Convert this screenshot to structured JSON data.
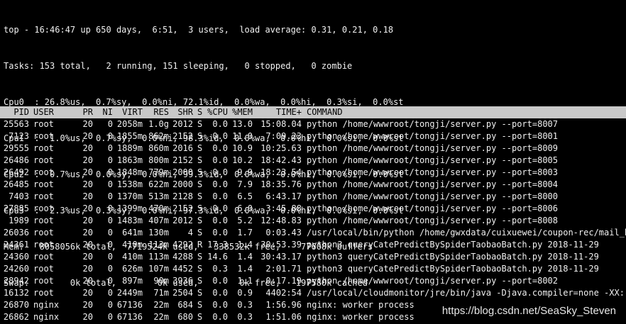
{
  "summary": {
    "uptime_line": "top - 16:46:47 up 650 days,  6:51,  3 users,  load average: 0.31, 0.21, 0.18",
    "tasks_line": "Tasks: 153 total,   2 running, 151 sleeping,   0 stopped,   0 zombie",
    "cpu_lines": [
      "Cpu0  : 26.8%us,  0.7%sy,  0.0%ni, 72.1%id,  0.0%wa,  0.0%hi,  0.3%si,  0.0%st",
      "Cpu1  :  1.0%us,  0.7%sy,  0.0%ni, 98.3%id,  0.0%wa,  0.0%hi,  0.0%si,  0.0%st",
      "Cpu2  :  0.7%us,  0.0%sy,  0.0%ni, 99.3%id,  0.0%wa,  0.0%hi,  0.0%si,  0.0%st",
      "Cpu3  :  2.3%us,  0.3%sy,  0.0%ni, 97.3%id,  0.0%wa,  0.0%hi,  0.0%si,  0.0%st"
    ],
    "mem_line": "Mem:   8058056k total,  7719524k used,   338532k free,    77608k buffers",
    "swap_line": "Swap:        0k total,        0k used,        0k free,   197580k cached"
  },
  "columns": [
    "PID",
    "USER",
    "PR",
    "NI",
    "VIRT",
    "RES",
    "SHR",
    "S",
    "%CPU",
    "%MEM",
    "TIME+",
    "COMMAND"
  ],
  "processes": [
    {
      "pid": "25563",
      "user": "root",
      "pr": "20",
      "ni": "0",
      "virt": "2058m",
      "res": "1.0g",
      "shr": "2012",
      "s": "S",
      "cpu": "0.0",
      "mem": "13.0",
      "time": "15:08.04",
      "command": "python /home/wwwroot/tongji/server.py --port=8007"
    },
    {
      "pid": "7123",
      "user": "root",
      "pr": "20",
      "ni": "0",
      "virt": "1855m",
      "res": "862m",
      "shr": "2152",
      "s": "S",
      "cpu": "0.0",
      "mem": "11.0",
      "time": "7:09.23",
      "command": "python /home/wwwroot/tongji/server.py --port=8001"
    },
    {
      "pid": "29555",
      "user": "root",
      "pr": "20",
      "ni": "0",
      "virt": "1889m",
      "res": "860m",
      "shr": "2016",
      "s": "S",
      "cpu": "0.0",
      "mem": "10.9",
      "time": "10:25.63",
      "command": "python /home/wwwroot/tongji/server.py --port=8009"
    },
    {
      "pid": "26486",
      "user": "root",
      "pr": "20",
      "ni": "0",
      "virt": "1863m",
      "res": "800m",
      "shr": "2152",
      "s": "S",
      "cpu": "0.0",
      "mem": "10.2",
      "time": "18:42.43",
      "command": "python /home/wwwroot/tongji/server.py --port=8005"
    },
    {
      "pid": "26492",
      "user": "root",
      "pr": "20",
      "ni": "0",
      "virt": "1848m",
      "res": "779m",
      "shr": "2000",
      "s": "S",
      "cpu": "0.0",
      "mem": "9.9",
      "time": "18:23.54",
      "command": "python /home/wwwroot/tongji/server.py --port=8003"
    },
    {
      "pid": "26485",
      "user": "root",
      "pr": "20",
      "ni": "0",
      "virt": "1538m",
      "res": "622m",
      "shr": "2000",
      "s": "S",
      "cpu": "0.0",
      "mem": "7.9",
      "time": "18:35.76",
      "command": "python /home/wwwroot/tongji/server.py --port=8004"
    },
    {
      "pid": "7403",
      "user": "root",
      "pr": "20",
      "ni": "0",
      "virt": "1370m",
      "res": "513m",
      "shr": "2128",
      "s": "S",
      "cpu": "0.0",
      "mem": "6.5",
      "time": "6:43.17",
      "command": "python /home/wwwroot/tongji/server.py --port=8000"
    },
    {
      "pid": "27885",
      "user": "root",
      "pr": "20",
      "ni": "0",
      "virt": "1399m",
      "res": "470m",
      "shr": "2152",
      "s": "S",
      "cpu": "0.0",
      "mem": "6.0",
      "time": "3:45.88",
      "command": "python /home/wwwroot/tongji/server.py --port=8006"
    },
    {
      "pid": "1989",
      "user": "root",
      "pr": "20",
      "ni": "0",
      "virt": "1483m",
      "res": "407m",
      "shr": "2012",
      "s": "S",
      "cpu": "0.0",
      "mem": "5.2",
      "time": "12:48.83",
      "command": "python /home/wwwroot/tongji/server.py --port=8008"
    },
    {
      "pid": "26036",
      "user": "root",
      "pr": "20",
      "ni": "0",
      "virt": "641m",
      "res": "130m",
      "shr": "4",
      "s": "S",
      "cpu": "0.0",
      "mem": "1.7",
      "time": "0:03.43",
      "command": "/usr/local/bin/python /home/gwxdata/cuixuewei/coupon-rec/mail_bas"
    },
    {
      "pid": "24361",
      "user": "root",
      "pr": "20",
      "ni": "0",
      "virt": "410m",
      "res": "113m",
      "shr": "4292",
      "s": "R",
      "cpu": "17.3",
      "mem": "1.4",
      "time": "30:53.39",
      "command": "python3 queryCatePredictBySpiderTaobaoBatch.py 2018-11-29"
    },
    {
      "pid": "24360",
      "user": "root",
      "pr": "20",
      "ni": "0",
      "virt": "410m",
      "res": "113m",
      "shr": "4288",
      "s": "S",
      "cpu": "14.6",
      "mem": "1.4",
      "time": "30:43.17",
      "command": "python3 queryCatePredictBySpiderTaobaoBatch.py 2018-11-29"
    },
    {
      "pid": "24260",
      "user": "root",
      "pr": "20",
      "ni": "0",
      "virt": "626m",
      "res": "107m",
      "shr": "4452",
      "s": "S",
      "cpu": "0.3",
      "mem": "1.4",
      "time": "2:01.71",
      "command": "python3 queryCatePredictBySpiderTaobaoBatch.py 2018-11-29"
    },
    {
      "pid": "28942",
      "user": "root",
      "pr": "20",
      "ni": "0",
      "virt": "897m",
      "res": "90m",
      "shr": "3936",
      "s": "S",
      "cpu": "0.0",
      "mem": "1.1",
      "time": "0:17.19",
      "command": "python /home/wwwroot/tongji/server.py --port=8002"
    },
    {
      "pid": "16132",
      "user": "root",
      "pr": "20",
      "ni": "0",
      "virt": "2449m",
      "res": "71m",
      "shr": "2504",
      "s": "S",
      "cpu": "0.0",
      "mem": "0.9",
      "time": "4402:54",
      "command": "/usr/local/cloudmonitor/jre/bin/java -Djava.compiler=none -XX:-U"
    },
    {
      "pid": "26870",
      "user": "nginx",
      "pr": "20",
      "ni": "0",
      "virt": "67136",
      "res": "22m",
      "shr": "684",
      "s": "S",
      "cpu": "0.0",
      "mem": "0.3",
      "time": "1:56.96",
      "command": "nginx: worker process"
    },
    {
      "pid": "26862",
      "user": "nginx",
      "pr": "20",
      "ni": "0",
      "virt": "67136",
      "res": "22m",
      "shr": "680",
      "s": "S",
      "cpu": "0.0",
      "mem": "0.3",
      "time": "1:51.06",
      "command": "nginx: worker process"
    }
  ],
  "watermark": "https://blog.csdn.net/SeaSky_Steven",
  "colors": {
    "background": "#000000",
    "text": "#f0f0f0",
    "header_bar": "#c8c8c8",
    "header_text": "#000000"
  }
}
